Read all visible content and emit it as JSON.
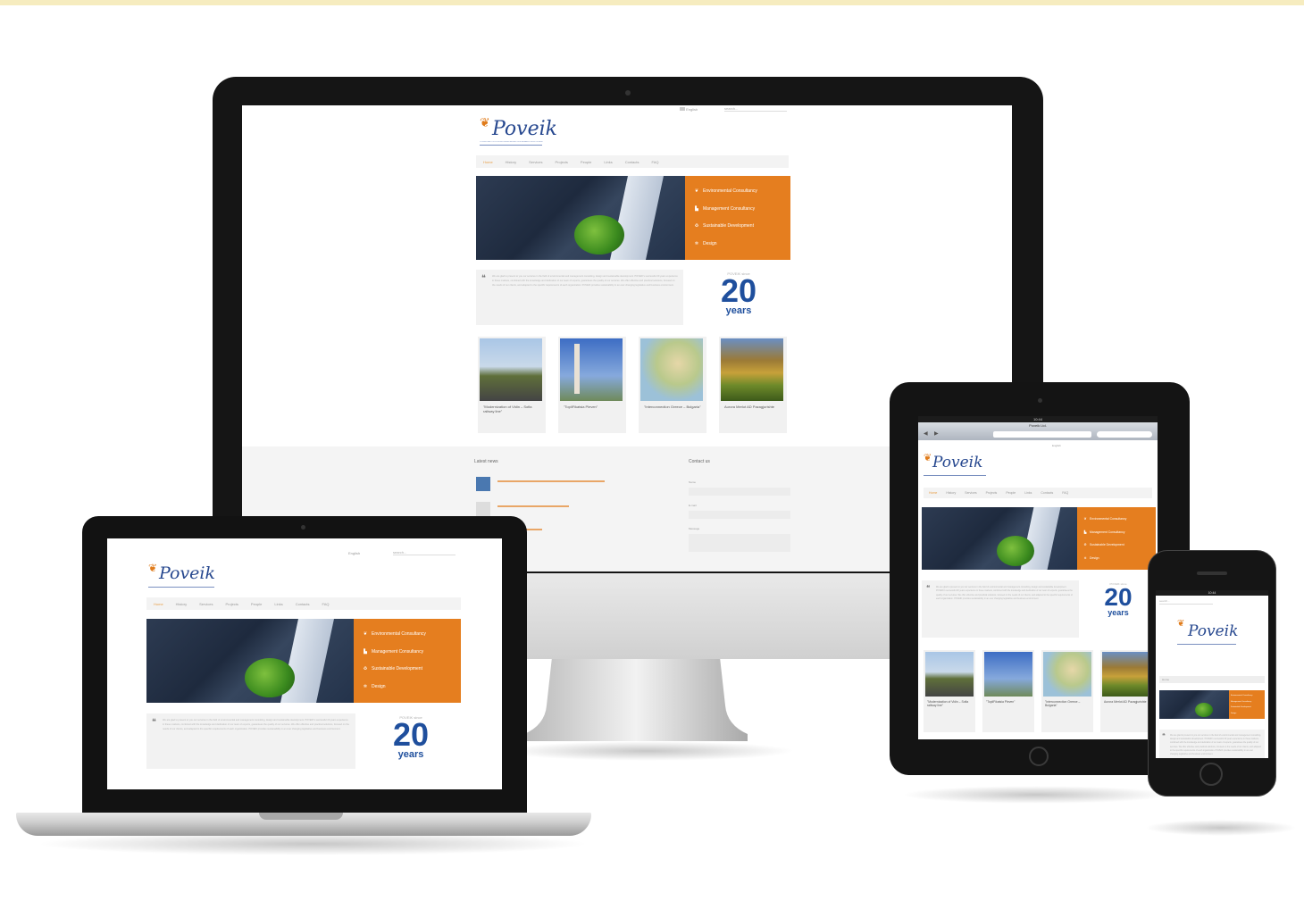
{
  "brand": {
    "name": "Poveik",
    "tagline": "CONSULTANTS FOR ENVIRONMENTAL AND SUSTAINABLE DEVELOPMENT"
  },
  "header": {
    "language": "English",
    "search_placeholder": "search..."
  },
  "menu": [
    "Home",
    "History",
    "Services",
    "Projects",
    "People",
    "Links",
    "Contacts",
    "FAQ"
  ],
  "services": [
    {
      "label": "Environmental Consultancy",
      "icon": "seedling-icon"
    },
    {
      "label": "Management Consultancy",
      "icon": "factory-icon"
    },
    {
      "label": "Sustainable Development",
      "icon": "recycle-icon"
    },
    {
      "label": "Design",
      "icon": "compass-icon"
    }
  ],
  "intro_quote": "We are glad to present to you our services in the field of environmental and management consulting, design and sustainable development. POVEIK's successful 20 years experience in these markets, combined with the knowledge and dedication of our team of experts, guarantees the quality of our services. We offer effective and practical solutions, focused on the needs of our clients, and adapted to the specific requirements of each organization. POVEIK provides sustainability in an ever changing legislative and business environment.",
  "anniversary": {
    "kicker": "POVEIK since",
    "number": "20",
    "unit": "years"
  },
  "projects": [
    {
      "caption": "\"Modernization of Vidin – Sofia railway line\"",
      "image": "railway-photo"
    },
    {
      "caption": "\"TopliFikatsia Pleven\"",
      "image": "power-plant-photo"
    },
    {
      "caption": "\"Interconnection Greece – Bulgaria\"",
      "image": "map-photo"
    },
    {
      "caption": "Aurora Merlot AD Pazagjurishte",
      "image": "vineyard-photo"
    }
  ],
  "footer": {
    "latest_news_title": "Latest news",
    "contact_title": "Contact us",
    "contact_fields": [
      "Name",
      "E-mail",
      "Message"
    ]
  },
  "tablet_browser": {
    "page_title": "Poveik Ltd.",
    "status_time": "10:44"
  },
  "phone_status": {
    "time": "10:44"
  }
}
